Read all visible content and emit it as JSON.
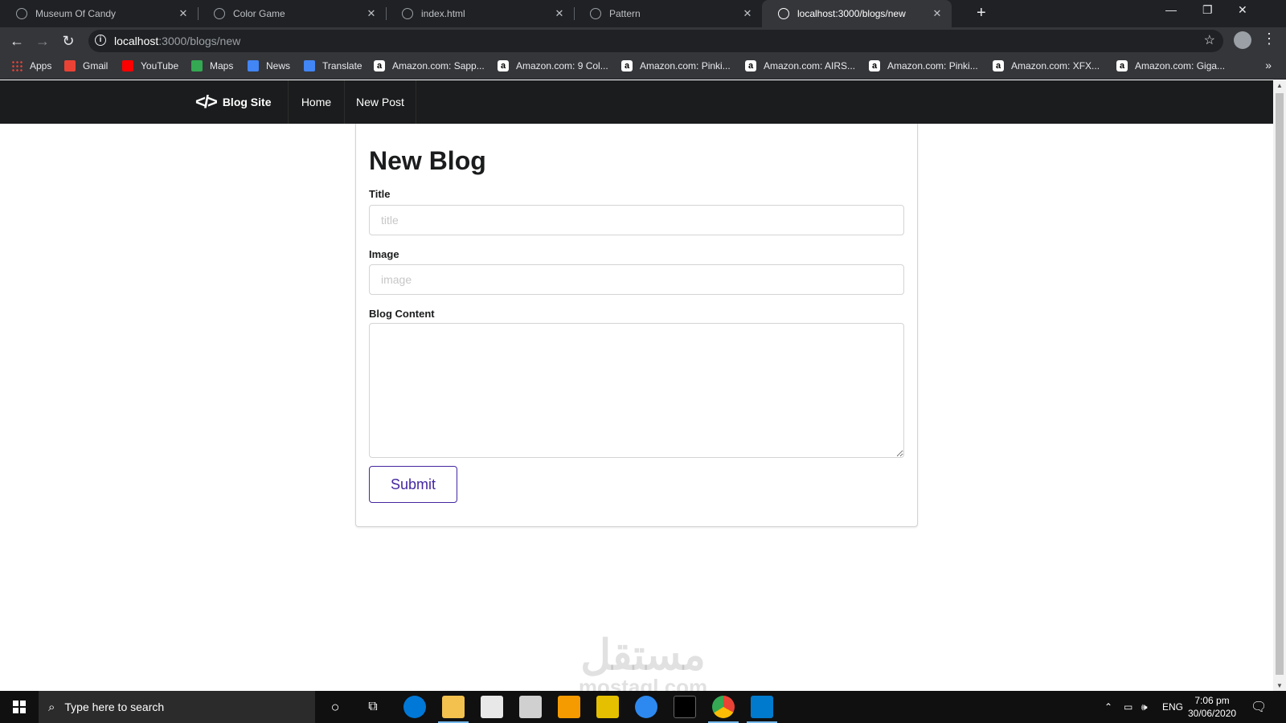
{
  "browser": {
    "tabs": [
      {
        "title": "Museum Of Candy",
        "active": false
      },
      {
        "title": "Color Game",
        "active": false
      },
      {
        "title": "index.html",
        "active": false
      },
      {
        "title": "Pattern",
        "active": false
      },
      {
        "title": "localhost:3000/blogs/new",
        "active": true
      }
    ],
    "url_host": "localhost",
    "url_path": ":3000/blogs/new",
    "bookmarks": [
      "Apps",
      "Gmail",
      "YouTube",
      "Maps",
      "News",
      "Translate",
      "Amazon.com: Sapp...",
      "Amazon.com: 9 Col...",
      "Amazon.com: Pinki...",
      "Amazon.com: AIRS...",
      "Amazon.com: Pinki...",
      "Amazon.com: XFX...",
      "Amazon.com: Giga..."
    ]
  },
  "site_nav": {
    "brand": "Blog Site",
    "items": [
      "Home",
      "New Post"
    ]
  },
  "form": {
    "heading": "New Blog",
    "title_label": "Title",
    "title_placeholder": "title",
    "image_label": "Image",
    "image_placeholder": "image",
    "content_label": "Blog Content",
    "submit_label": "Submit"
  },
  "watermark": {
    "line1": "مستقل",
    "line2": "mostaql.com"
  },
  "taskbar": {
    "search_placeholder": "Type here to search",
    "language": "ENG",
    "time": "7:06 pm",
    "date": "30/06/2020"
  },
  "colors": {
    "site_nav_bg": "#1b1c1d",
    "submit_accent": "#4527a0",
    "chrome_dark": "#202124"
  }
}
